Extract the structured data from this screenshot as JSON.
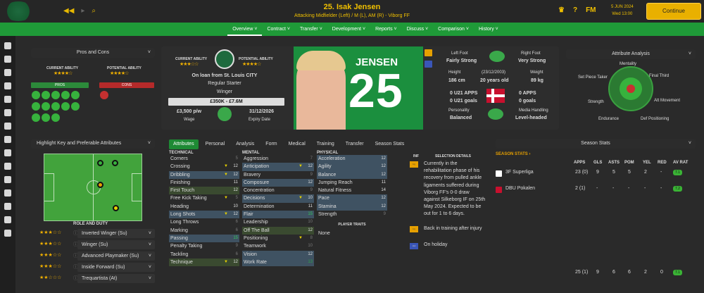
{
  "header": {
    "title": "25. Isak Jensen",
    "subtitle": "Attacking Midfielder (Left) / M (L), AM (R) - Viborg FF",
    "date_line1": "5 JUN 2024",
    "date_line2": "Wed 13:00",
    "fm": "FM",
    "continue": "Continue"
  },
  "menu": [
    "Overview ˅",
    "Contract ˅",
    "Transfer ˅",
    "Development ˅",
    "Reports ˅",
    "Discuss ˅",
    "Comparison ˅",
    "History ˅"
  ],
  "pros_cons": {
    "title": "Pros and Cons",
    "ca_label": "CURRENT ABILITY",
    "pa_label": "POTENTIAL ABILITY",
    "pros": "PROS",
    "cons": "CONS"
  },
  "card": {
    "ca_label": "CURRENT ABILITY",
    "pa_label": "POTENTIAL ABILITY",
    "loan": "On loan from St. Louis CITY",
    "status": "Regular Starter",
    "position": "Winger",
    "value": "£350K - £7.6M",
    "wage": "£3,500 p/w",
    "wage_label": "Wage",
    "expiry": "31/12/2026",
    "expiry_label": "Expiry Date",
    "surname": "JENSEN",
    "number": "25"
  },
  "bio": {
    "left_foot_label": "Left Foot",
    "left_foot": "Fairly Strong",
    "right_foot_label": "Right Foot",
    "right_foot": "Very Strong",
    "height_label": "Height",
    "height": "186 cm",
    "dob": "(23/12/2003)",
    "age": "20 years old",
    "weight_label": "Weight",
    "weight": "89 kg",
    "u21_apps": "0 U21 APPS",
    "u21_goals": "0 U21 goals",
    "apps": "0 APPS",
    "goals": "0 goals",
    "personality_label": "Personality",
    "personality": "Balanced",
    "media_label": "Media Handling",
    "media": "Level-headed"
  },
  "analysis": {
    "title": "Attribute Analysis",
    "mentality": "Mentality",
    "set_piece": "Set Piece Taker",
    "final_third": "Final Third",
    "strength": "Strength",
    "att_movement": "Att Movement",
    "endurance": "Endurance",
    "def_positioning": "Def Positioning"
  },
  "highlight": {
    "title": "Highlight Key and Preferable Attributes",
    "role_duty": "ROLE AND DUTY"
  },
  "roles": [
    {
      "name": "Inverted Winger (Su)"
    },
    {
      "name": "Winger (Su)"
    },
    {
      "name": "Advanced Playmaker (Su)"
    },
    {
      "name": "Inside Forward (Su)"
    },
    {
      "name": "Trequartista (At)"
    }
  ],
  "tabs": [
    "Attributes",
    "Personal",
    "Analysis",
    "Form",
    "Medical",
    "Training",
    "Transfer",
    "Season Stats"
  ],
  "technical": {
    "header": "TECHNICAL",
    "rows": [
      {
        "n": "Corners",
        "v": "5"
      },
      {
        "n": "Crossing",
        "v": "12"
      },
      {
        "n": "Dribbling",
        "v": "12"
      },
      {
        "n": "Finishing",
        "v": "11"
      },
      {
        "n": "First Touch",
        "v": "12"
      },
      {
        "n": "Free Kick Taking",
        "v": "5"
      },
      {
        "n": "Heading",
        "v": "10"
      },
      {
        "n": "Long Shots",
        "v": "12"
      },
      {
        "n": "Long Throws",
        "v": "6"
      },
      {
        "n": "Marking",
        "v": "6"
      },
      {
        "n": "Passing",
        "v": "15"
      },
      {
        "n": "Penalty Taking",
        "v": "9"
      },
      {
        "n": "Tackling",
        "v": "6"
      },
      {
        "n": "Technique",
        "v": "12"
      }
    ]
  },
  "mental": {
    "header": "MENTAL",
    "rows": [
      {
        "n": "Aggression",
        "v": "7"
      },
      {
        "n": "Anticipation",
        "v": "12"
      },
      {
        "n": "Bravery",
        "v": "9"
      },
      {
        "n": "Composure",
        "v": "12"
      },
      {
        "n": "Concentration",
        "v": "9"
      },
      {
        "n": "Decisions",
        "v": "10"
      },
      {
        "n": "Determination",
        "v": "11"
      },
      {
        "n": "Flair",
        "v": "15"
      },
      {
        "n": "Leadership",
        "v": "10"
      },
      {
        "n": "Off The Ball",
        "v": "12"
      },
      {
        "n": "Positioning",
        "v": "8"
      },
      {
        "n": "Teamwork",
        "v": "10"
      },
      {
        "n": "Vision",
        "v": "12"
      },
      {
        "n": "Work Rate",
        "v": "13"
      }
    ]
  },
  "physical": {
    "header": "PHYSICAL",
    "rows": [
      {
        "n": "Acceleration",
        "v": "12"
      },
      {
        "n": "Agility",
        "v": "12"
      },
      {
        "n": "Balance",
        "v": "12"
      },
      {
        "n": "Jumping Reach",
        "v": "11"
      },
      {
        "n": "Natural Fitness",
        "v": "14"
      },
      {
        "n": "Pace",
        "v": "12"
      },
      {
        "n": "Stamina",
        "v": "12"
      },
      {
        "n": "Strength",
        "v": "9"
      }
    ]
  },
  "traits": {
    "header": "PLAYER TRAITS",
    "value": "None"
  },
  "inf": {
    "header": "INF",
    "sel": "SELECTION DETAILS",
    "i1": "Currently in the rehabilitation phase of his recovery from pulled ankle ligaments suffered during Viborg FF's 0-0 draw against Silkeborg IF on 25th May 2024. Expected to be out for 1 to 6 days.",
    "i2": "Back in training after injury",
    "i3": "On holiday",
    "b1": "Inj",
    "b2": "Inj",
    "b3": "Hol"
  },
  "season": {
    "title": "Season Stats",
    "link": "SEASON STATS ›",
    "cols": [
      "APPS",
      "GLS",
      "ASTS",
      "POM",
      "YEL",
      "RED",
      "AV RAT"
    ],
    "rows": [
      {
        "comp": "3F Superliga",
        "apps": "23 (0)",
        "gls": "9",
        "asts": "5",
        "pom": "5",
        "yel": "2",
        "red": "-",
        "rat": "7.1"
      },
      {
        "comp": "DBU Pokalen",
        "apps": "2 (1)",
        "gls": "-",
        "asts": "-",
        "pom": "-",
        "yel": "-",
        "red": "-",
        "rat": "7.2"
      }
    ],
    "total": {
      "apps": "25 (1)",
      "gls": "9",
      "asts": "6",
      "pom": "6",
      "yel": "2",
      "red": "0",
      "rat": "7.1"
    }
  },
  "colors": {
    "accent": "#1f9a38",
    "gold": "#f0c000"
  }
}
